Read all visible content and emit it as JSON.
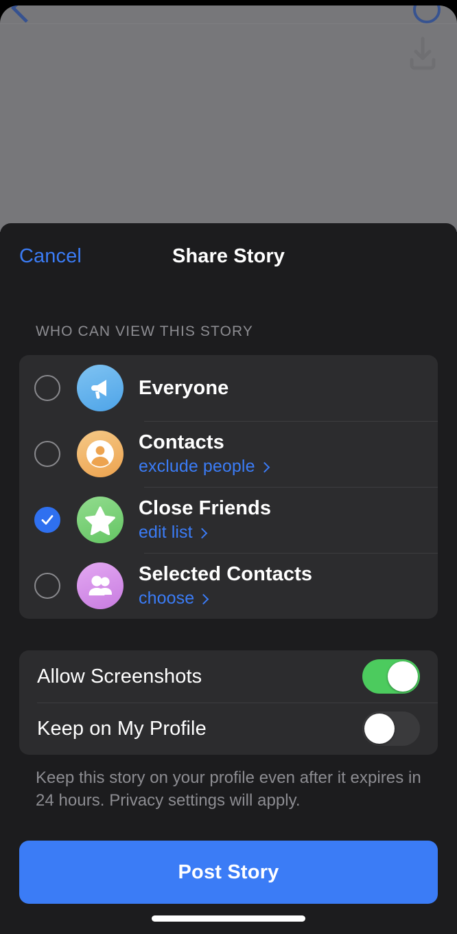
{
  "background": {
    "back_icon": "chevron-left-icon",
    "circle_icon": "circle-outline-icon",
    "download_icon": "download-icon"
  },
  "nav": {
    "cancel_label": "Cancel",
    "title": "Share Story"
  },
  "audience": {
    "section_header": "WHO CAN VIEW THIS STORY",
    "options": [
      {
        "title": "Everyone",
        "sub": "",
        "icon": "megaphone-icon",
        "selected": false,
        "color": "#4ea4e8"
      },
      {
        "title": "Contacts",
        "sub": "exclude people",
        "icon": "person-circle-icon",
        "selected": false,
        "color": "#eda34f"
      },
      {
        "title": "Close Friends",
        "sub": "edit list",
        "icon": "star-icon",
        "selected": true,
        "color": "#64c563"
      },
      {
        "title": "Selected Contacts",
        "sub": "choose",
        "icon": "group-icon",
        "selected": false,
        "color": "#c87ce0"
      }
    ]
  },
  "settings": {
    "toggles": [
      {
        "label": "Allow Screenshots",
        "on": true
      },
      {
        "label": "Keep on My Profile",
        "on": false
      }
    ],
    "footnote": "Keep this story on your profile even after it expires in 24 hours. Privacy settings will apply."
  },
  "actions": {
    "post_label": "Post Story"
  },
  "colors": {
    "accent_blue": "#3b7cf6",
    "toggle_on_green": "#4ccb5e",
    "sheet_bg": "#1c1c1e",
    "card_bg": "#2c2c2e"
  }
}
